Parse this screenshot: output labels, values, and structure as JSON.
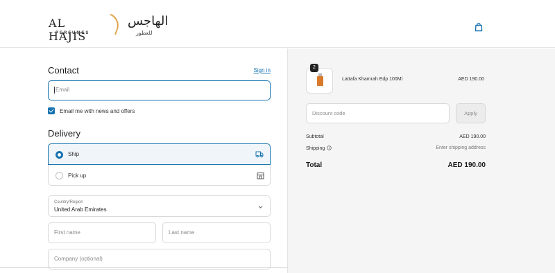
{
  "header": {
    "logo_en": "AL HAJIS",
    "logo_en_sub": "PERFUMES",
    "logo_ar": "الهاجس",
    "logo_ar_sub": "للعطور",
    "cart_icon": "shopping-bag-icon"
  },
  "contact": {
    "heading": "Contact",
    "signin_label": "Sign in",
    "email_placeholder": "Email",
    "newsletter_label": "Email me with news and offers",
    "newsletter_checked": true
  },
  "delivery": {
    "heading": "Delivery",
    "options": [
      {
        "label": "Ship",
        "selected": true,
        "icon": "truck-icon"
      },
      {
        "label": "Pick up",
        "selected": false,
        "icon": "store-icon"
      }
    ],
    "country_caption": "Country/Region",
    "country_value": "United Arab Emirates",
    "first_name_placeholder": "First name",
    "last_name_placeholder": "Last name",
    "company_placeholder": "Company (optional)"
  },
  "summary": {
    "product": {
      "name": "Lattafa Khamrah Edp 100Ml",
      "price": "AED 190.00",
      "quantity": "2"
    },
    "discount_placeholder": "Discount code",
    "apply_label": "Apply",
    "subtotal_label": "Subtotal",
    "subtotal_value": "AED 190.00",
    "shipping_label": "Shipping",
    "shipping_value": "Enter shipping address",
    "total_label": "Total",
    "total_value": "AED 190.00"
  },
  "colors": {
    "accent": "#1773b0",
    "summary_bg": "#f5f5f5",
    "logo_gold": "#e0a24a"
  }
}
